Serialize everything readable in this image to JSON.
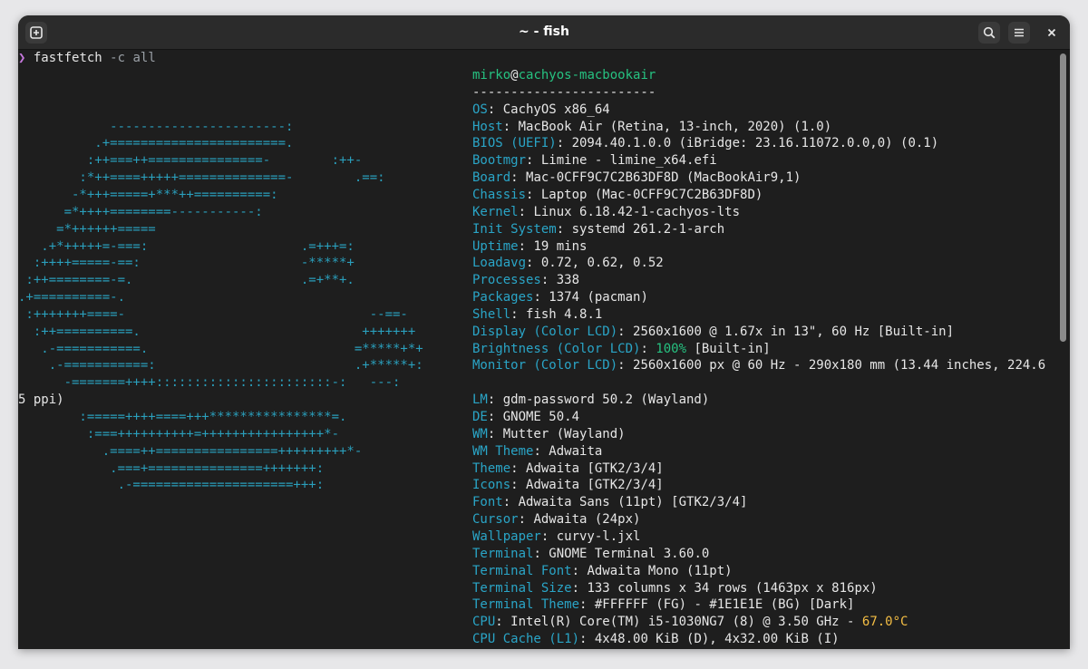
{
  "window": {
    "title": "~ - fish"
  },
  "prompt": {
    "symbol": "❯",
    "command": "fastfetch",
    "args": "-c all"
  },
  "ascii_art": [
    {
      "text": "",
      "color": "#2a9fbc"
    },
    {
      "text": "",
      "color": "#2a9fbc"
    },
    {
      "text": "",
      "color": "#2a9fbc"
    },
    {
      "text": "            -----------------------:",
      "color": "#2a9fbc"
    },
    {
      "text": "          .+=======================.",
      "color": "#2a9fbc"
    },
    {
      "text": "         :++===++===============-        :++-",
      "color": "#2a9fbc"
    },
    {
      "text": "        :*++====+++++==============-        .==:",
      "color": "#2a9fbc"
    },
    {
      "text": "       -*+++=====+***++==========:",
      "color": "#2a9fbc"
    },
    {
      "text": "      =*++++========-----------:",
      "color": "#2a9fbc"
    },
    {
      "text": "     =*++++++=====",
      "color": "#2a9fbc"
    },
    {
      "text": "   .+*+++++=-===:                    .=+++=:",
      "color": "#2a9fbc"
    },
    {
      "text": "  :++++=====-==:                     -*****+",
      "color": "#2a9fbc"
    },
    {
      "text": " :++========-=.                      .=+**+.",
      "color": "#2a9fbc"
    },
    {
      "text": ".+==========-.",
      "color": "#2a9fbc"
    },
    {
      "text": " :+++++++====-                                --==-",
      "color": "#2a9fbc"
    },
    {
      "text": "  :++==========.                             +++++++",
      "color": "#2a9fbc"
    },
    {
      "text": "   .-===========.                           =*****+*+",
      "color": "#2a9fbc"
    },
    {
      "text": "    .-===========:                          .+*****+:",
      "color": "#2a9fbc"
    },
    {
      "text": "      -=======++++:::::::::::::::::::::::-:   ---:",
      "color": "#2a9fbc"
    },
    {
      "text": "5 ppi)",
      "color": "#e6e6e6"
    },
    {
      "text": "        :=====++++====+++****************=.",
      "color": "#2a9fbc"
    },
    {
      "text": "         :===++++++++++=++++++++++++++++*-",
      "color": "#2a9fbc"
    },
    {
      "text": "           .====++================+++++++++*-",
      "color": "#2a9fbc"
    },
    {
      "text": "            .===+===============+++++++:",
      "color": "#2a9fbc"
    },
    {
      "text": "             .-=====================+++:",
      "color": "#2a9fbc"
    },
    {
      "text": "",
      "color": "#2a9fbc"
    }
  ],
  "info": {
    "user": "mirko",
    "at": "@",
    "host": "cachyos-macbookair",
    "separator": "------------------------",
    "lines": [
      {
        "key": "OS",
        "value": "CachyOS x86_64"
      },
      {
        "key": "Host",
        "value": "MacBook Air (Retina, 13-inch, 2020) (1.0)"
      },
      {
        "key": "BIOS (UEFI)",
        "value": "2094.40.1.0.0 (iBridge: 23.16.11072.0.0,0) (0.1)"
      },
      {
        "key": "Bootmgr",
        "value": "Limine - limine_x64.efi"
      },
      {
        "key": "Board",
        "value": "Mac-0CFF9C7C2B63DF8D (MacBookAir9,1)"
      },
      {
        "key": "Chassis",
        "value": "Laptop (Mac-0CFF9C7C2B63DF8D)"
      },
      {
        "key": "Kernel",
        "value": "Linux 6.18.42-1-cachyos-lts"
      },
      {
        "key": "Init System",
        "value": "systemd 261.2-1-arch"
      },
      {
        "key": "Uptime",
        "value": "19 mins"
      },
      {
        "key": "Loadavg",
        "value": "0.72, 0.62, 0.52"
      },
      {
        "key": "Processes",
        "value": "338"
      },
      {
        "key": "Packages",
        "value": "1374 (pacman)"
      },
      {
        "key": "Shell",
        "value": "fish 4.8.1"
      },
      {
        "key": "Display (Color LCD)",
        "value": "2560x1600 @ 1.67x in 13\", 60 Hz [Built-in]"
      },
      {
        "key": "Brightness (Color LCD)",
        "value_pre": "",
        "value_hl": "100%",
        "value_post": " [Built-in]",
        "hl_color": "#26c281"
      },
      {
        "key": "Monitor (Color LCD)",
        "value": "2560x1600 px @ 60 Hz - 290x180 mm (13.44 inches, 224.6"
      },
      {
        "key": "",
        "value": ""
      },
      {
        "key": "LM",
        "value": "gdm-password 50.2 (Wayland)"
      },
      {
        "key": "DE",
        "value": "GNOME 50.4"
      },
      {
        "key": "WM",
        "value": "Mutter (Wayland)"
      },
      {
        "key": "WM Theme",
        "value": "Adwaita"
      },
      {
        "key": "Theme",
        "value": "Adwaita [GTK2/3/4]"
      },
      {
        "key": "Icons",
        "value": "Adwaita [GTK2/3/4]"
      },
      {
        "key": "Font",
        "value": "Adwaita Sans (11pt) [GTK2/3/4]"
      },
      {
        "key": "Cursor",
        "value": "Adwaita (24px)"
      },
      {
        "key": "Wallpaper",
        "value": "curvy-l.jxl"
      },
      {
        "key": "Terminal",
        "value": "GNOME Terminal 3.60.0"
      },
      {
        "key": "Terminal Font",
        "value": "Adwaita Mono (11pt)"
      },
      {
        "key": "Terminal Size",
        "value": "133 columns x 34 rows (1463px x 816px)"
      },
      {
        "key": "Terminal Theme",
        "value": "#FFFFFF (FG) - #1E1E1E (BG) [Dark]"
      },
      {
        "key": "CPU",
        "value_pre": "Intel(R) Core(TM) i5-1030NG7 (8) @ 3.50 GHz - ",
        "value_hl": "67.0°C",
        "value_post": "",
        "hl_color": "#f3bd44"
      },
      {
        "key": "CPU Cache (L1)",
        "value": "4x48.00 KiB (D), 4x32.00 KiB (I)"
      }
    ]
  },
  "colors": {
    "key": "#2aa5c7",
    "user": "#26c281",
    "background": "#1e1e1e",
    "foreground": "#e6e6e6"
  }
}
